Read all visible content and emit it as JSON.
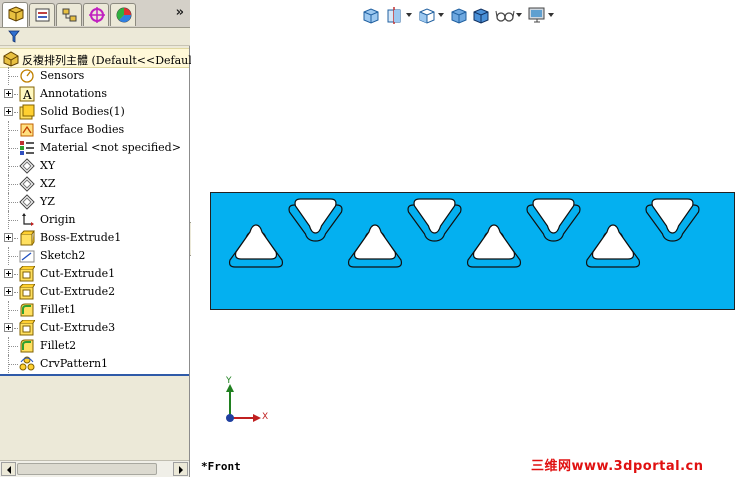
{
  "feature_tree": {
    "root_label": "反複排列主體  (Default<<Default>",
    "items": [
      {
        "label": "Sensors",
        "icon": "sensor-icon",
        "expandable": false
      },
      {
        "label": "Annotations",
        "icon": "annotation-icon",
        "expandable": true
      },
      {
        "label": "Solid Bodies(1)",
        "icon": "solid-bodies-icon",
        "expandable": true
      },
      {
        "label": "Surface Bodies",
        "icon": "surface-bodies-icon",
        "expandable": false
      },
      {
        "label": "Material <not specified>",
        "icon": "material-icon",
        "expandable": false
      },
      {
        "label": "XY",
        "icon": "plane-icon",
        "expandable": false
      },
      {
        "label": "XZ",
        "icon": "plane-icon",
        "expandable": false
      },
      {
        "label": "YZ",
        "icon": "plane-icon",
        "expandable": false
      },
      {
        "label": "Origin",
        "icon": "origin-icon",
        "expandable": false
      },
      {
        "label": "Boss-Extrude1",
        "icon": "extrude-icon",
        "expandable": true
      },
      {
        "label": "Sketch2",
        "icon": "sketch-icon",
        "expandable": false
      },
      {
        "label": "Cut-Extrude1",
        "icon": "cut-extrude-icon",
        "expandable": true
      },
      {
        "label": "Cut-Extrude2",
        "icon": "cut-extrude-icon",
        "expandable": true
      },
      {
        "label": "Fillet1",
        "icon": "fillet-icon",
        "expandable": false
      },
      {
        "label": "Cut-Extrude3",
        "icon": "cut-extrude-icon",
        "expandable": true
      },
      {
        "label": "Fillet2",
        "icon": "fillet-icon",
        "expandable": false
      },
      {
        "label": "CrvPattern1",
        "icon": "curve-pattern-icon",
        "expandable": false
      }
    ]
  },
  "panel_tabs": {
    "more_label": "»"
  },
  "viewport": {
    "view_name": "*Front",
    "triad_y": "Y",
    "triad_x": "X",
    "part_color": "#04b0f0",
    "slot_count": 8
  },
  "watermark": "三维网www.3dportal.cn",
  "colors": {
    "selection_line": "#2f5aa8",
    "watermark": "#e01010"
  }
}
